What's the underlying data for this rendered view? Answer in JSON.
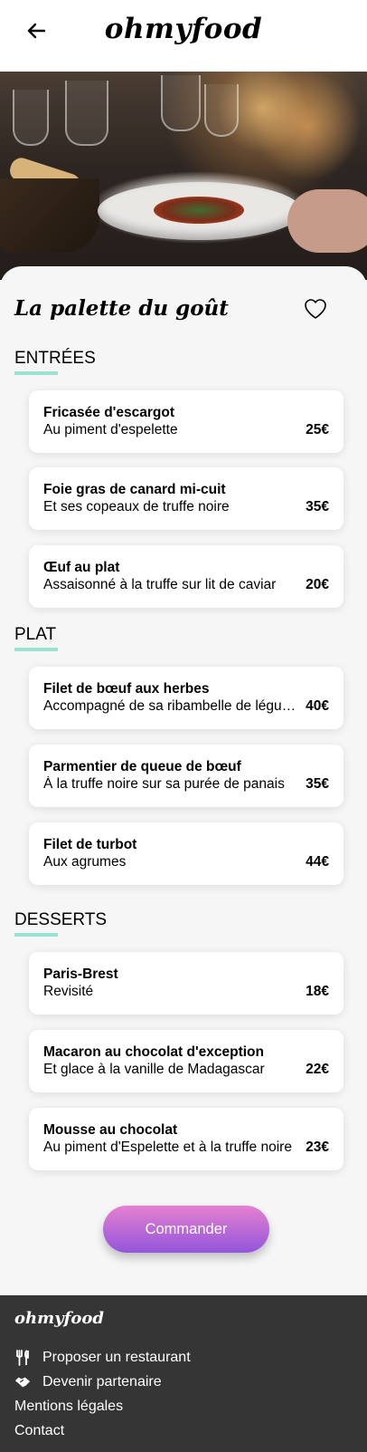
{
  "header": {
    "back_icon": "arrow-left-icon",
    "logo": "ohmyfood"
  },
  "hero": {
    "image": "restaurant-table-photo"
  },
  "restaurant": {
    "name": "La palette du goût",
    "favorite_icon": "heart-outline-icon"
  },
  "sections": [
    {
      "title": "ENTRÉES",
      "items": [
        {
          "name": "Fricasée d'escargot",
          "description": "Au piment d'espelette",
          "price": "25€"
        },
        {
          "name": "Foie gras de canard mi-cuit",
          "description": "Et ses copeaux de truffe noire",
          "price": "35€"
        },
        {
          "name": "Œuf au plat",
          "description": "Assaisonné à la truffe sur lit de caviar",
          "price": "20€"
        }
      ]
    },
    {
      "title": "PLAT",
      "items": [
        {
          "name": "Filet de bœuf aux herbes",
          "description": "Accompagné de sa ribambelle de légumes",
          "price": "40€"
        },
        {
          "name": "Parmentier de queue de bœuf",
          "description": "À la truffe noire sur sa purée de panais",
          "price": "35€"
        },
        {
          "name": "Filet de turbot",
          "description": "Aux agrumes",
          "price": "44€"
        }
      ]
    },
    {
      "title": "DESSERTS",
      "items": [
        {
          "name": "Paris-Brest",
          "description": "Revisité",
          "price": "18€"
        },
        {
          "name": "Macaron au chocolat d'exception",
          "description": "Et glace à la vanille de Madagascar",
          "price": "22€"
        },
        {
          "name": "Mousse au chocolat",
          "description": "Au piment d'Espelette et à la truffe noire",
          "price": "23€"
        }
      ]
    }
  ],
  "order_button": "Commander",
  "colors": {
    "accent_underline": "#99e2d0",
    "button_gradient_top": "#e580cf",
    "button_gradient_bottom": "#9356dc",
    "footer_bg": "#353535"
  },
  "footer": {
    "logo": "ohmyfood",
    "links": [
      {
        "label": "Proposer un restaurant",
        "icon": "utensils-icon"
      },
      {
        "label": "Devenir partenaire",
        "icon": "handshake-icon"
      },
      {
        "label": "Mentions légales",
        "icon": ""
      },
      {
        "label": "Contact",
        "icon": ""
      }
    ]
  }
}
